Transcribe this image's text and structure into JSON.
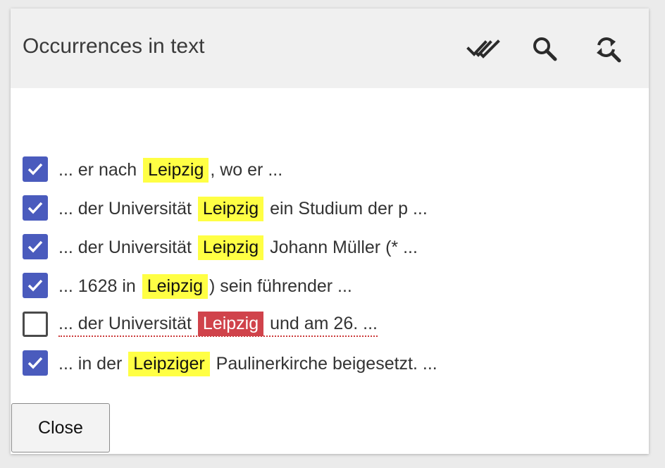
{
  "dialog": {
    "title": "Occurrences in text",
    "toolbar": {
      "icons": [
        "select-all-icon",
        "search-icon",
        "search-replace-icon"
      ]
    },
    "occurrences": [
      {
        "checked": true,
        "before": "... er nach ",
        "match": "Leipzig",
        "after": ", wo er ...",
        "error": false
      },
      {
        "checked": true,
        "before": "... der Universität ",
        "match": "Leipzig",
        "after": " ein Studium der p ...",
        "error": false
      },
      {
        "checked": true,
        "before": "... der Universität ",
        "match": "Leipzig",
        "after": " Johann Müller (* ...",
        "error": false
      },
      {
        "checked": true,
        "before": "... 1628 in ",
        "match": "Leipzig",
        "after": ") sein führender ...",
        "error": false
      },
      {
        "checked": false,
        "before": "... der Universität ",
        "match": "Leipzig",
        "after": " und am 26. ...",
        "error": true
      },
      {
        "checked": true,
        "before": "... in der ",
        "match": "Leipziger",
        "after": " Paulinerkirche beigesetzt. ...",
        "error": false
      }
    ],
    "close_label": "Close"
  },
  "colors": {
    "highlight": "#ffff44",
    "error_highlight": "#d0434b",
    "checkbox_checked": "#4a5bbd",
    "header_bg": "#f0f0f0"
  }
}
